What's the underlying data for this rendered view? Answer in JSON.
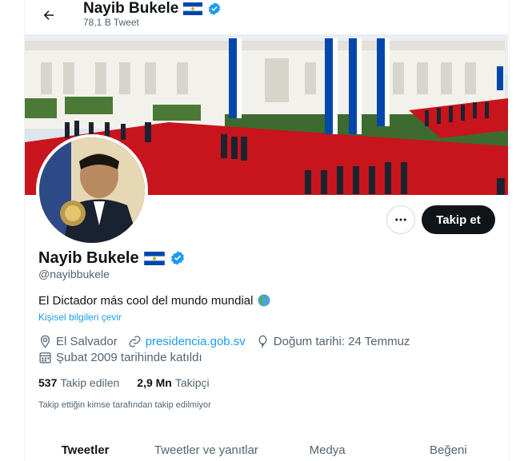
{
  "header": {
    "name": "Nayib Bukele",
    "tweet_count": "78,1 B Tweet"
  },
  "profile": {
    "name": "Nayib Bukele",
    "handle": "@nayibbukele",
    "bio": "El Dictador más cool del mundo mundial",
    "bio_emoji_icon": "globe-americas-icon",
    "translate_label": "Kişisel bilgileri çevir",
    "location": "El Salvador",
    "website": "presidencia.gob.sv",
    "birthday": "Doğum tarihi: 24 Temmuz",
    "joined": "Şubat 2009 tarihinde katıldı",
    "following_count": "537",
    "following_label": "Takip edilen",
    "followers_count": "2,9 Mn",
    "followers_label": "Takipçi",
    "followed_by_note": "Takip ettiğin kimse tarafından takip edilmiyor"
  },
  "actions": {
    "follow_label": "Takip et",
    "more_icon": "more-horizontal-icon"
  },
  "tabs": [
    {
      "label": "Tweetler",
      "active": true
    },
    {
      "label": "Tweetler ve yanıtlar",
      "active": false
    },
    {
      "label": "Medya",
      "active": false
    },
    {
      "label": "Beğeni",
      "active": false
    }
  ],
  "colors": {
    "accent": "#1d9bf0",
    "verified": "#1d9bf0",
    "text_secondary": "#536471",
    "flag_blue": "#0047ab"
  }
}
